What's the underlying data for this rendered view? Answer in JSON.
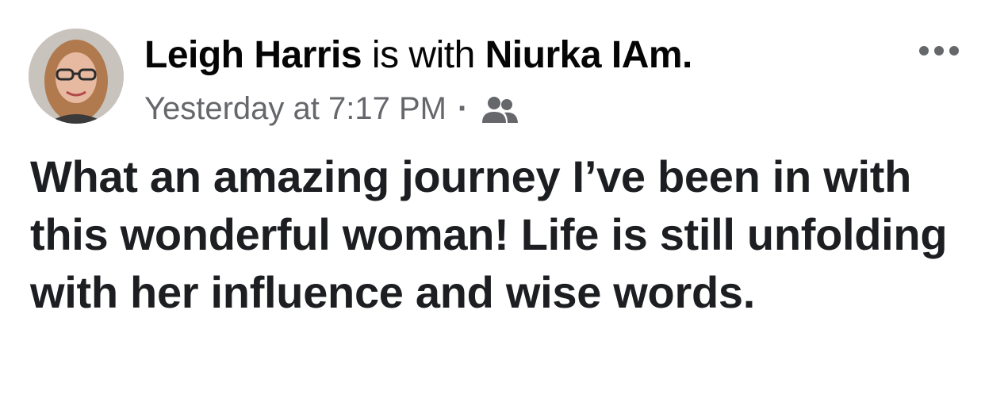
{
  "post": {
    "author_name": "Leigh Harris",
    "with_text": "is with",
    "tagged_name": "Niurka IAm",
    "header_period": ".",
    "timestamp": "Yesterday at 7:17 PM",
    "separator": "·",
    "audience_icon": "friends-icon",
    "more_icon": "more-horizontal-icon",
    "body": "What an amazing journey I’ve been in with this wonderful woman! Life is still unfolding with her influence and wise words."
  },
  "colors": {
    "primary_text": "#050505",
    "secondary_text": "#65676b",
    "background": "#ffffff"
  }
}
